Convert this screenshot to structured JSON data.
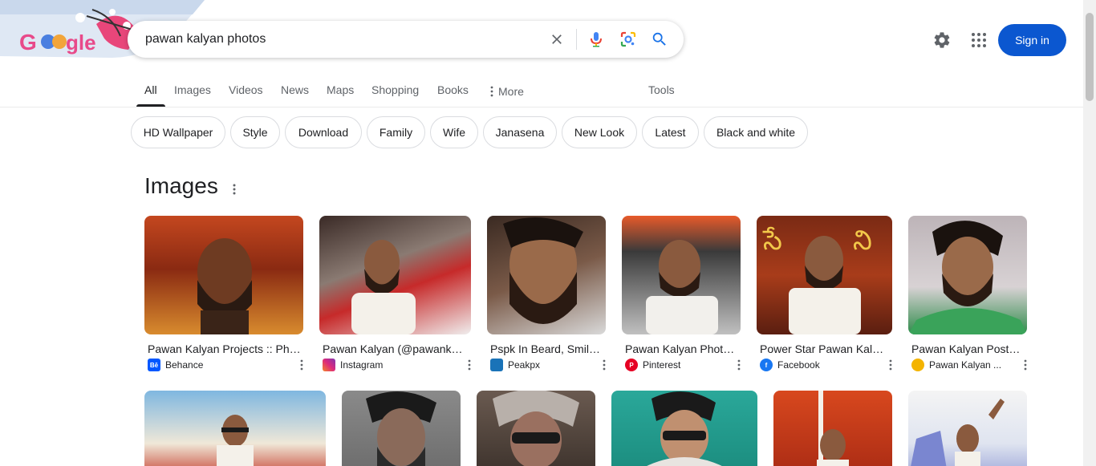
{
  "search": {
    "query": "pawan kalyan photos"
  },
  "header": {
    "signin_label": "Sign in",
    "icons": [
      "settings-icon",
      "apps-icon"
    ]
  },
  "tabs": [
    {
      "label": "All",
      "active": true
    },
    {
      "label": "Images"
    },
    {
      "label": "Videos"
    },
    {
      "label": "News"
    },
    {
      "label": "Maps"
    },
    {
      "label": "Shopping"
    },
    {
      "label": "Books"
    },
    {
      "label": "More"
    }
  ],
  "tools_label": "Tools",
  "chips": [
    "HD Wallpaper",
    "Style",
    "Download",
    "Family",
    "Wife",
    "Janasena",
    "New Look",
    "Latest",
    "Black and white"
  ],
  "images_section": {
    "title": "Images",
    "results": [
      {
        "title": "Pawan Kalyan Projects :: Pho...",
        "source": "Behance",
        "favicon_color": "#0057ff",
        "favicon_text": "Bē"
      },
      {
        "title": "Pawan Kalyan (@pawankal...",
        "source": "Instagram",
        "favicon_color": "#c13584",
        "favicon_text": ""
      },
      {
        "title": "Pspk In Beard, Smile,...",
        "source": "Peakpx",
        "favicon_color": "#1a73b8",
        "favicon_text": ""
      },
      {
        "title": "Pawan Kalyan Photo...",
        "source": "Pinterest",
        "favicon_color": "#e60023",
        "favicon_text": "P"
      },
      {
        "title": "Power Star Pawan Kalyan",
        "source": "Facebook",
        "favicon_color": "#1877f2",
        "favicon_text": "f"
      },
      {
        "title": "Pawan Kalyan Poster...",
        "source": "Pawan Kalyan ...",
        "favicon_color": "#f4b400",
        "favicon_text": ""
      }
    ]
  },
  "colors": {
    "accent": "#0b57d0",
    "text": "#202124",
    "muted": "#5f6368"
  }
}
